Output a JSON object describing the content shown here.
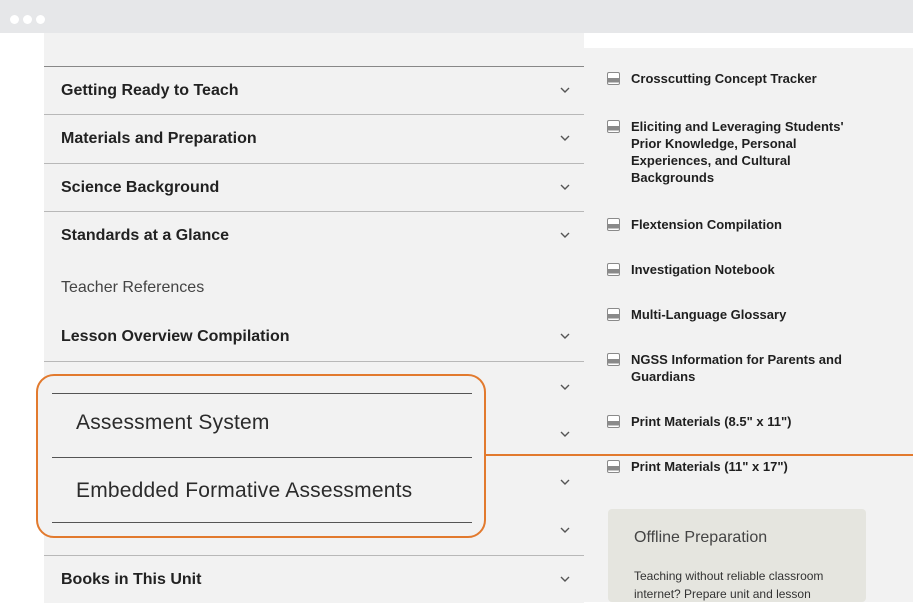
{
  "accordion": {
    "top_items": [
      {
        "label": "Getting Ready to Teach"
      },
      {
        "label": "Materials and Preparation"
      },
      {
        "label": "Science Background"
      },
      {
        "label": "Standards at a Glance"
      }
    ],
    "section_heading": "Teacher References",
    "lesson_overview": "Lesson Overview Compilation",
    "books": "Books in This Unit"
  },
  "callout": {
    "item1": "Assessment System",
    "item2": "Embedded Formative Assessments"
  },
  "resources": [
    {
      "label": "Crosscutting Concept Tracker"
    },
    {
      "label": "Eliciting and Leveraging Students' Prior Knowledge, Personal Experiences, and Cultural Backgrounds"
    },
    {
      "label": "Flextension Compilation"
    },
    {
      "label": "Investigation Notebook"
    },
    {
      "label": "Multi-Language Glossary"
    },
    {
      "label": "NGSS Information for Parents and Guardians"
    },
    {
      "label": "Print Materials (8.5\" x 11\")"
    },
    {
      "label": "Print Materials (11\" x 17\")"
    }
  ],
  "offline": {
    "heading": "Offline Preparation",
    "text": "Teaching without reliable classroom internet? Prepare unit and lesson"
  },
  "colors": {
    "accent": "#e27a2e",
    "panel": "#f2f2f2"
  },
  "icons": {
    "pdf": "pdf-icon",
    "chevron": "chevron-down-icon"
  }
}
